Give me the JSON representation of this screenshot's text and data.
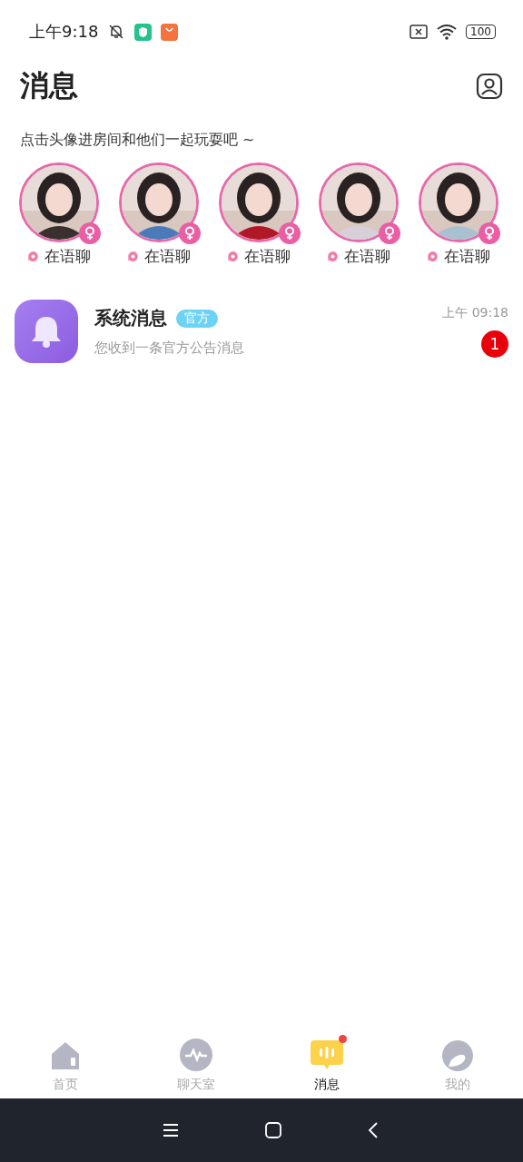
{
  "status_bar": {
    "time": "上午9:18",
    "battery": "100"
  },
  "header": {
    "title": "消息"
  },
  "rooms": {
    "hint": "点击头像进房间和他们一起玩耍吧 ~",
    "items": [
      {
        "label": "在语聊",
        "female": true,
        "color": "#3a3030"
      },
      {
        "label": "在语聊",
        "female": true,
        "color": "#4a7ab8"
      },
      {
        "label": "在语聊",
        "female": true,
        "color": "#b01828"
      },
      {
        "label": "在语聊",
        "female": true,
        "color": "#d8d0d8"
      },
      {
        "label": "在语聊",
        "female": true,
        "color": "#a8c0d0"
      }
    ]
  },
  "messages": [
    {
      "title": "系统消息",
      "tag": "官方",
      "preview": "您收到一条官方公告消息",
      "time": "上午 09:18",
      "unread": "1"
    }
  ],
  "tabs": [
    {
      "label": "首页",
      "kind": "home",
      "selected": false,
      "dot": false
    },
    {
      "label": "聊天室",
      "kind": "wave",
      "selected": false,
      "dot": false
    },
    {
      "label": "消息",
      "kind": "chat",
      "selected": true,
      "dot": true
    },
    {
      "label": "我的",
      "kind": "me",
      "selected": false,
      "dot": false
    }
  ]
}
